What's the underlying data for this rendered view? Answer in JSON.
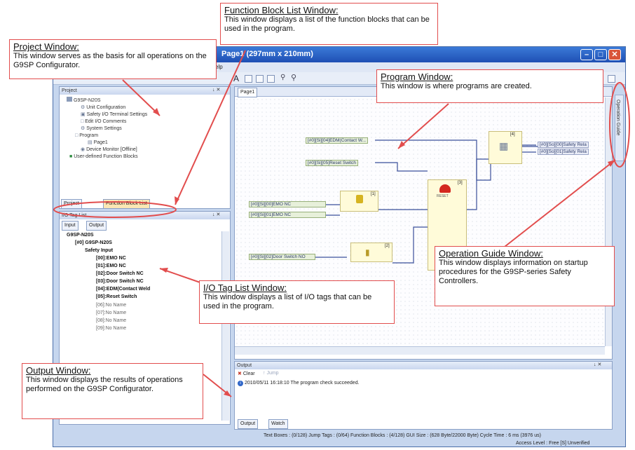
{
  "window": {
    "title": "Page1 (297mm x 210mm)",
    "menu_fragment": "elp",
    "toolbar_letter": "A"
  },
  "project_pane": {
    "header": "Project",
    "pin": "↓ ✕",
    "tree": [
      "G9SP-N20S",
      "Unit Configuration",
      "Safety I/O Terminal Settings",
      "Edit I/O Comments",
      "System Settings",
      "Program",
      "Page1",
      "Device Monitor [Offline]",
      "User-defined Function Blocks"
    ],
    "tabs": [
      "Project",
      "Function Block List"
    ]
  },
  "io_pane": {
    "header": "I/O Tag List",
    "pin": "↓ ✕",
    "tabs": [
      "Input",
      "Output"
    ],
    "tree": [
      "G9SP-N20S",
      "[#0] G9SP-N20S",
      "Safety Input",
      "[00]:EMO NC",
      "[01]:EMO NC",
      "[02]:Door Switch NC",
      "[03]:Door Switch NC",
      "[04]:EDM(Contact Weld",
      "[05]:Reset Switch",
      "[06]:No Name",
      "[07]:No Name",
      "[08]:No Name",
      "[09]:No Name"
    ]
  },
  "editor": {
    "tab": "Page1",
    "tags": [
      "[#0][Si][04]EDM(Contact W...",
      "[#0][Si][05]Reset Switch",
      "[#0][Si][00]EMO NC",
      "[#0][Si][01]EMO NC",
      "[#0][Si][02]Door Switch NO"
    ],
    "outputs": [
      "[#0][So][00]Safety Rela",
      "[#0][So][01]Safety Rela"
    ],
    "block_labels": [
      "[4]",
      "[3]",
      "[1]",
      "[2]"
    ],
    "reset_label": "RESET",
    "side_tab": "Operation Guide"
  },
  "output_pane": {
    "header": "Output",
    "pin": "↓ ✕",
    "clear": "Clear",
    "jump": "Jump",
    "message": "2010/05/11 16:18:10 The program check succeeded.",
    "tabs": [
      "Output",
      "Watch"
    ]
  },
  "statusbar": {
    "line1": "Text Boxes : (0/128)   Jump Tags : (0/64)   Function Blocks : (4/128)   GUI Size : (628 Byte/22000 Byte)   Cycle Time : 6 ms (3976 us)",
    "line2": "Access Level : Free   [S] Unverified"
  },
  "callouts": {
    "function_block": {
      "title": "Function Block List Window:",
      "body": "This window displays a list of the function blocks that can be used in the program."
    },
    "project": {
      "title": "Project Window:",
      "body": "This window serves as the basis for all operations on the G9SP Configurator."
    },
    "program": {
      "title": "Program Window:",
      "body": "This window is where programs are created."
    },
    "operation_guide": {
      "title": "Operation Guide Window:",
      "body": "This window displays information on startup procedures for the G9SP-series Safety Controllers."
    },
    "io_tag": {
      "title": "I/O Tag List Window",
      "title_suffix": ":",
      "body": "This window displays a list of I/O tags that can be used in the program."
    },
    "output": {
      "title": "Output Window:",
      "body": "This window displays the results of operations performed on the G9SP Configurator."
    }
  },
  "colors": {
    "callout_border": "#e24d4d",
    "titlebar": "#2356c4",
    "tag_fill": "#e7f0da",
    "fb_fill": "#fffbd9"
  }
}
